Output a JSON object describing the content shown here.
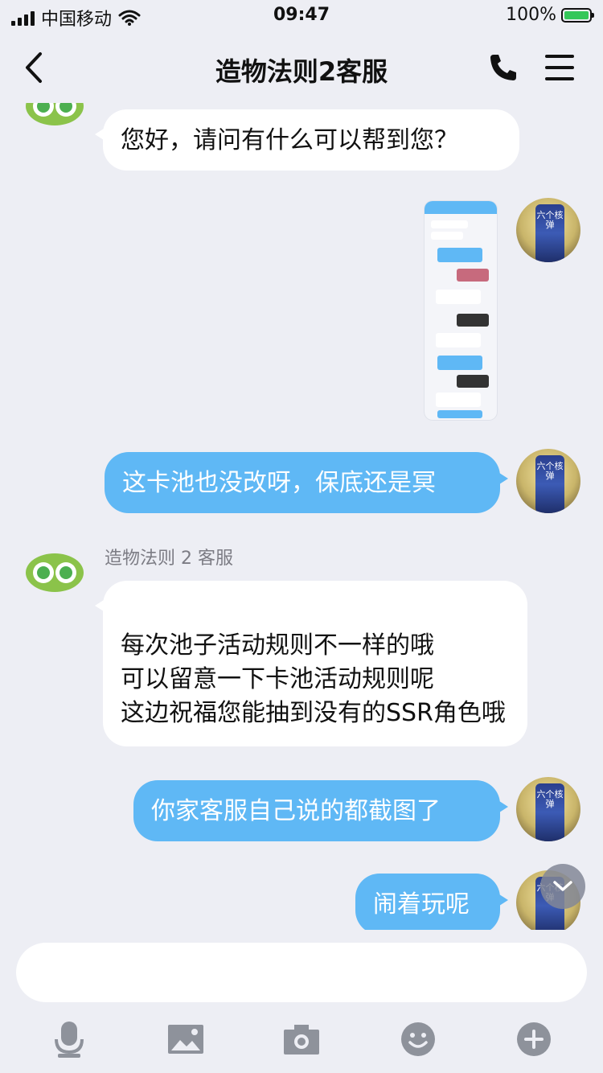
{
  "status_bar": {
    "carrier": "中国移动",
    "time": "09:47",
    "battery": "100%",
    "battery_level": 1.0,
    "battery_color": "#34c759"
  },
  "nav": {
    "title": "造物法则2客服",
    "back_icon": "chevron-left-icon",
    "phone_icon": "phone-icon",
    "menu_icon": "hamburger-menu-icon"
  },
  "colors": {
    "background": "#edeef4",
    "bubble_self": "#5fb8f5",
    "bubble_other": "#ffffff"
  },
  "messages": [
    {
      "from": "kefu",
      "text": "您好，请问有什么可以帮到您？"
    },
    {
      "from": "user",
      "type": "image"
    },
    {
      "from": "user",
      "text": "这卡池也没改呀，保底还是冥"
    },
    {
      "from": "kefu",
      "sender": "造物法则 2 客服",
      "text": "每次池子活动规则不一样的哦\n可以留意一下卡池活动规则呢\n这边祝福您能抽到没有的SSR角色哦"
    },
    {
      "from": "user",
      "text": "你家客服自己说的都截图了"
    },
    {
      "from": "user",
      "text": "闹着玩呢"
    }
  ],
  "avatar_user_text": "六个核弹",
  "composer": {
    "placeholder": "",
    "tools": [
      "microphone-icon",
      "image-icon",
      "camera-icon",
      "emoji-icon",
      "plus-icon"
    ]
  }
}
